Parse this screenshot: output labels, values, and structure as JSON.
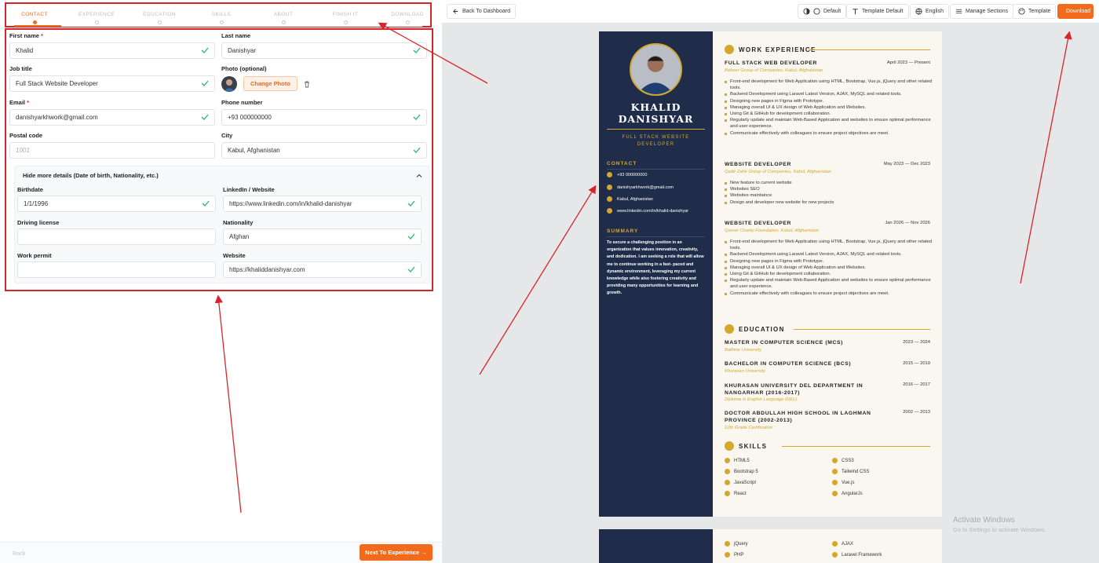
{
  "stepper": {
    "steps": [
      "CONTACT",
      "EXPERIENCE",
      "EDUCATION",
      "SKILLS",
      "ABOUT",
      "FINISH IT",
      "DOWNLOAD"
    ],
    "active_step": "CONTACT"
  },
  "form": {
    "first_name": {
      "label": "First name",
      "required": "*",
      "value": "Khalid"
    },
    "last_name": {
      "label": "Last name",
      "value": "Danishyar"
    },
    "job_title": {
      "label": "Job title",
      "value": "Full Stack Website Developer"
    },
    "photo": {
      "label": "Photo (optional)",
      "button": "Change Photo"
    },
    "email": {
      "label": "Email",
      "required": "*",
      "value": "danishyarkhwork@gmail.com"
    },
    "phone": {
      "label": "Phone number",
      "value": "+93 000000000"
    },
    "postal": {
      "label": "Postal code",
      "placeholder": "1001"
    },
    "city": {
      "label": "City",
      "value": "Kabul, Afghanistan"
    },
    "details_toggle": "Hide more details (Date of birth, Nationality, etc.)",
    "birthdate": {
      "label": "Birthdate",
      "value": "1/1/1996"
    },
    "linkedin": {
      "label": "LinkedIn / Website",
      "value": "https://www.linkedin.com/in/khalid-danishyar"
    },
    "driving": {
      "label": "Driving license",
      "value": ""
    },
    "nationality": {
      "label": "Nationality",
      "value": "Afghan"
    },
    "work_permit": {
      "label": "Work permit",
      "value": ""
    },
    "website": {
      "label": "Website",
      "value": "https://khaliddanishyar.com"
    }
  },
  "footer": {
    "back": "Back",
    "next": "Next To Experience →"
  },
  "toolbar": {
    "back_dashboard": "Back To Dashboard",
    "default": "Default",
    "template_default": "Template Default",
    "english": "English",
    "manage_sections": "Manage Sections",
    "template": "Template",
    "download": "Download"
  },
  "resume": {
    "first_name": "KHALID",
    "last_name": "DANISHYAR",
    "job": "FULL STACK WEBSITE DEVELOPER",
    "contact_head": "CONTACT",
    "contacts": [
      "+93 000000000",
      "danishyarkhwork@gmail.com",
      "Kabul, Afghanistan",
      "www.linkedin.com/in/khalid-danishyar"
    ],
    "summary_head": "SUMMARY",
    "summary": "To secure a challenging position in an organization that values innovation, creativity, and dedication. I am seeking a role that will allow me to continue working in a fast- paced and dynamic environment, leveraging my current knowledge while also fostering creativity and providing many opportunities for learning and growth.",
    "work_head": "WORK EXPERIENCE",
    "jobs": [
      {
        "title": "FULL STACK WEB DEVELOPER",
        "date": "April 2023 — Present",
        "org": "Baheer Group of Companies, Kabul, Afghanistan",
        "bullets": [
          "Front-end development for Web Application using HTML, Bootstrap, Vue.js, jQuery and other related tools.",
          "Backend Development using Laravel Latest Version, AJAX, MySQL and related tools.",
          "Designing new pages in Figma with Prototype.",
          "Managing overall UI & UX design of Web Application and Websites.",
          "Using Git & GitHub for development collaboration.",
          "Regularly update and maintain Web-Based Application and websites to ensure optimal performance and user experience.",
          "Communicate effectively with colleagues to ensure project objectives are meet."
        ]
      },
      {
        "title": "WEBSITE DEVELOPER",
        "date": "May 2023 — Dec 2023",
        "org": "Qadir Zahir Group of Companies, Kabul, Afghanistan",
        "bullets": [
          "New feature to current website",
          "Websites SEO",
          "Websites maintaince",
          "Design and developer new website for new projects"
        ]
      },
      {
        "title": "WEBSITE DEVELOPER",
        "date": "Jan 2026 — Nov 2026",
        "org": "Qamar Charity Foundation, Kabul, Afghanistan",
        "bullets": [
          "Front-end development for Web Application using HTML, Bootstrap, Vue.js, jQuery and other related tools.",
          "Backend Development using Laravel Latest Version, AJAX, MySQL and related tools.",
          "Designing new pages in Figma with Prototype.",
          "Managing overall UI & UX design of Web Application and Websites.",
          "Using Git & GitHub for development collaboration.",
          "Regularly update and maintain Web-Based Application and websites to ensure optimal performance and user experience.",
          "Communicate effectively with colleagues to ensure project objectives are meet."
        ]
      }
    ],
    "edu_head": "EDUCATION",
    "education": [
      {
        "title": "MASTER IN COMPUTER SCIENCE (MCS)",
        "date": "2023 — 2024",
        "org": "Bakhtar University"
      },
      {
        "title": "BACHELOR IN COMPUTER SCIENCE (BCS)",
        "date": "2015 — 2019",
        "org": "Khurasan University"
      },
      {
        "title": "KHURASAN UNIVERSITY DEL DEPARTMENT IN NANGARHAR (2016-2017)",
        "date": "2016 — 2017",
        "org": "Diploma in English Language (DEL)"
      },
      {
        "title": "DOCTOR ABDULLAH HIGH SCHOOL IN LAGHMAN PROVINCE (2002-2013)",
        "date": "2002 — 2013",
        "org": "12th Grade Certification"
      }
    ],
    "skills_head": "SKILLS",
    "skills": [
      "HTML5",
      "CSS3",
      "Bootstrap 5",
      "Tailwind CSS",
      "JavaScript",
      "Vue.js",
      "React",
      "AngularJs"
    ],
    "skills_page2": [
      "jQuery",
      "AJAX",
      "PHP",
      "Laravel Framework"
    ]
  },
  "watermark": {
    "line1": "Activate Windows",
    "line2": "Go to Settings to activate Windows."
  },
  "colors": {
    "accent": "#f26b1d",
    "gold": "#d5a72e",
    "navy": "#1f2d4a",
    "annotation": "#d6262b"
  }
}
